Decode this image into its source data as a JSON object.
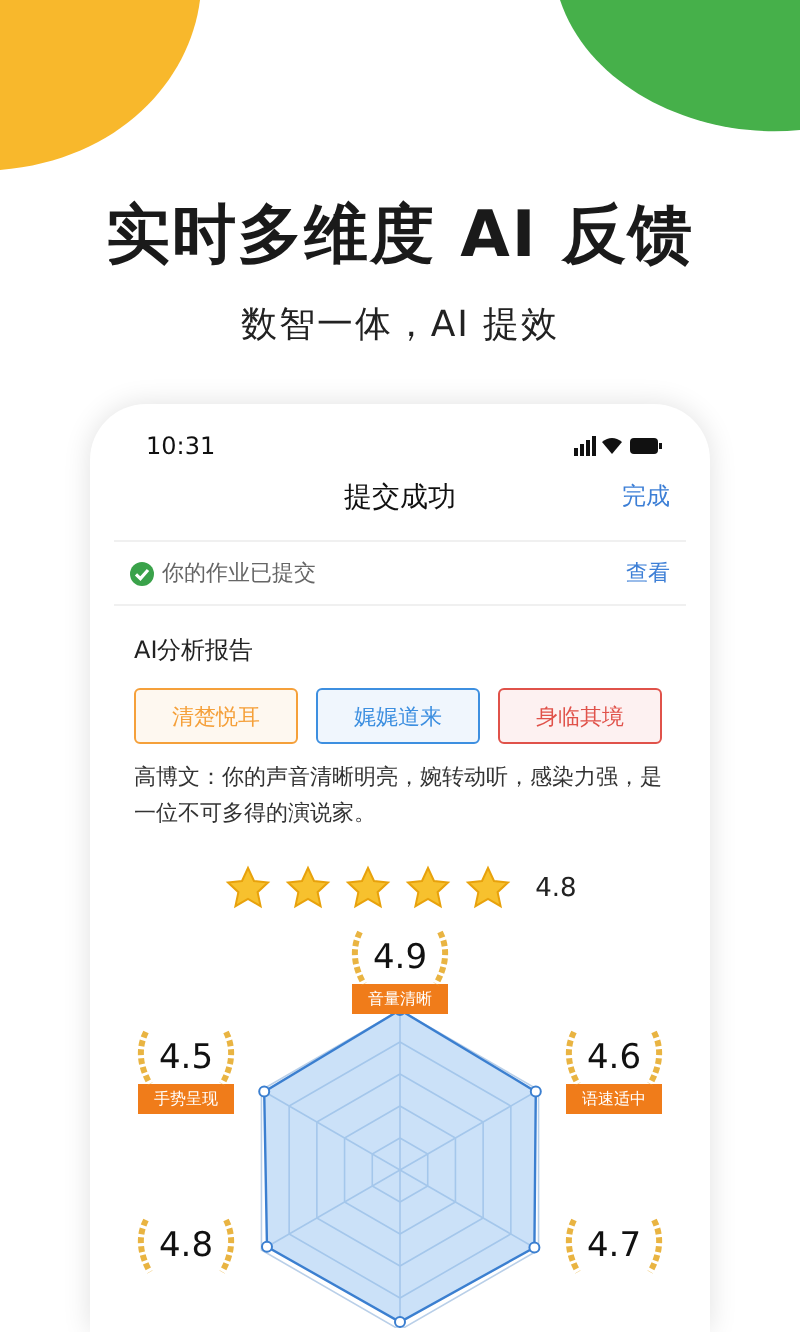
{
  "headline": "实时多维度 AI 反馈",
  "subline": "数智一体，AI 提效",
  "phone": {
    "status_time": "10:31",
    "nav": {
      "title": "提交成功",
      "action": "完成"
    },
    "notice": {
      "text": "你的作业已提交",
      "link": "查看"
    },
    "report_title": "AI分析报告",
    "tags": [
      {
        "label": "清楚悦耳",
        "color": "#f5a03a"
      },
      {
        "label": "娓娓道来",
        "color": "#3d8fe0"
      },
      {
        "label": "身临其境",
        "color": "#e0524a"
      }
    ],
    "comment": "高博文：你的声音清晰明亮，婉转动听，感染力强，是一位不可多得的演说家。",
    "rating": {
      "stars": 5,
      "score": "4.8"
    },
    "badges": [
      {
        "score": "4.9",
        "label": "音量清晰"
      },
      {
        "score": "4.5",
        "label": "手势呈现"
      },
      {
        "score": "4.6",
        "label": "语速适中"
      },
      {
        "score": "4.8"
      },
      {
        "score": "4.7"
      }
    ]
  }
}
